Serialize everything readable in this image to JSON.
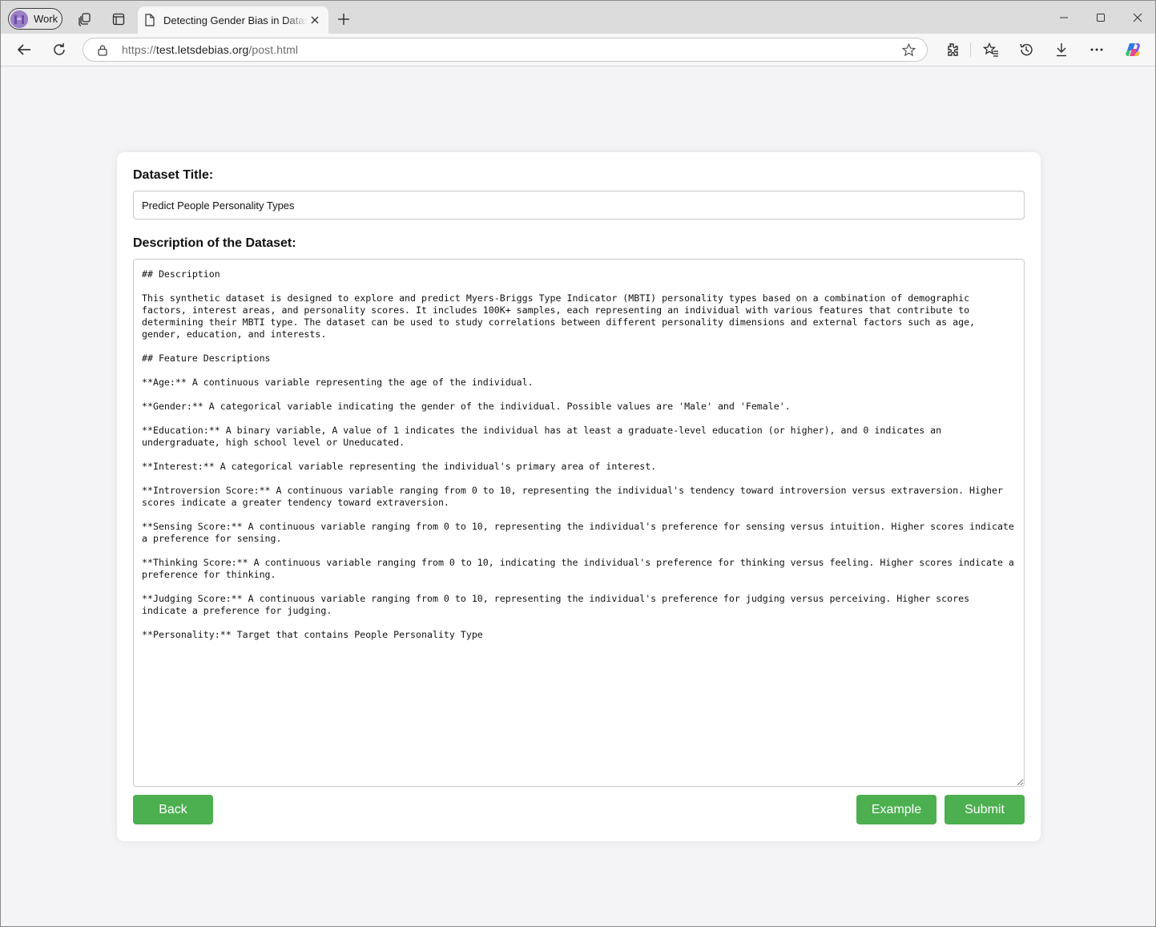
{
  "browser": {
    "profile_label": "Work",
    "tab_title": "Detecting Gender Bias in Datasets",
    "url_prefix": "https://",
    "url_host": "test.letsdebias.org",
    "url_path": "/post.html",
    "icons": [
      "profile-avatar",
      "workspaces-icon",
      "tab-actions-icon",
      "page-icon",
      "close-icon",
      "plus-icon",
      "minimize-icon",
      "maximize-icon",
      "close-window-icon",
      "back-icon",
      "refresh-icon",
      "lock-icon",
      "star-icon",
      "extensions-icon",
      "favorites-icon",
      "history-icon",
      "download-icon",
      "more-icon",
      "copilot-icon"
    ]
  },
  "form": {
    "title_label": "Dataset Title:",
    "title_value": "Predict People Personality Types",
    "description_label": "Description of the Dataset:",
    "description_value": "## Description\n\nThis synthetic dataset is designed to explore and predict Myers-Briggs Type Indicator (MBTI) personality types based on a combination of demographic factors, interest areas, and personality scores. It includes 100K+ samples, each representing an individual with various features that contribute to determining their MBTI type. The dataset can be used to study correlations between different personality dimensions and external factors such as age, gender, education, and interests.\n\n## Feature Descriptions\n\n**Age:** A continuous variable representing the age of the individual.\n\n**Gender:** A categorical variable indicating the gender of the individual. Possible values are 'Male' and 'Female'.\n\n**Education:** A binary variable, A value of 1 indicates the individual has at least a graduate-level education (or higher), and 0 indicates an undergraduate, high school level or Uneducated.\n\n**Interest:** A categorical variable representing the individual's primary area of interest.\n\n**Introversion Score:** A continuous variable ranging from 0 to 10, representing the individual's tendency toward introversion versus extraversion. Higher scores indicate a greater tendency toward extraversion.\n\n**Sensing Score:** A continuous variable ranging from 0 to 10, representing the individual's preference for sensing versus intuition. Higher scores indicate a preference for sensing.\n\n**Thinking Score:** A continuous variable ranging from 0 to 10, indicating the individual's preference for thinking versus feeling. Higher scores indicate a preference for thinking.\n\n**Judging Score:** A continuous variable ranging from 0 to 10, representing the individual's preference for judging versus perceiving. Higher scores indicate a preference for judging.\n\n**Personality:** Target that contains People Personality Type",
    "back_label": "Back",
    "example_label": "Example",
    "submit_label": "Submit"
  },
  "colors": {
    "button_green": "#4caf50",
    "page_background": "#f4f4f6",
    "card_background": "#ffffff"
  }
}
